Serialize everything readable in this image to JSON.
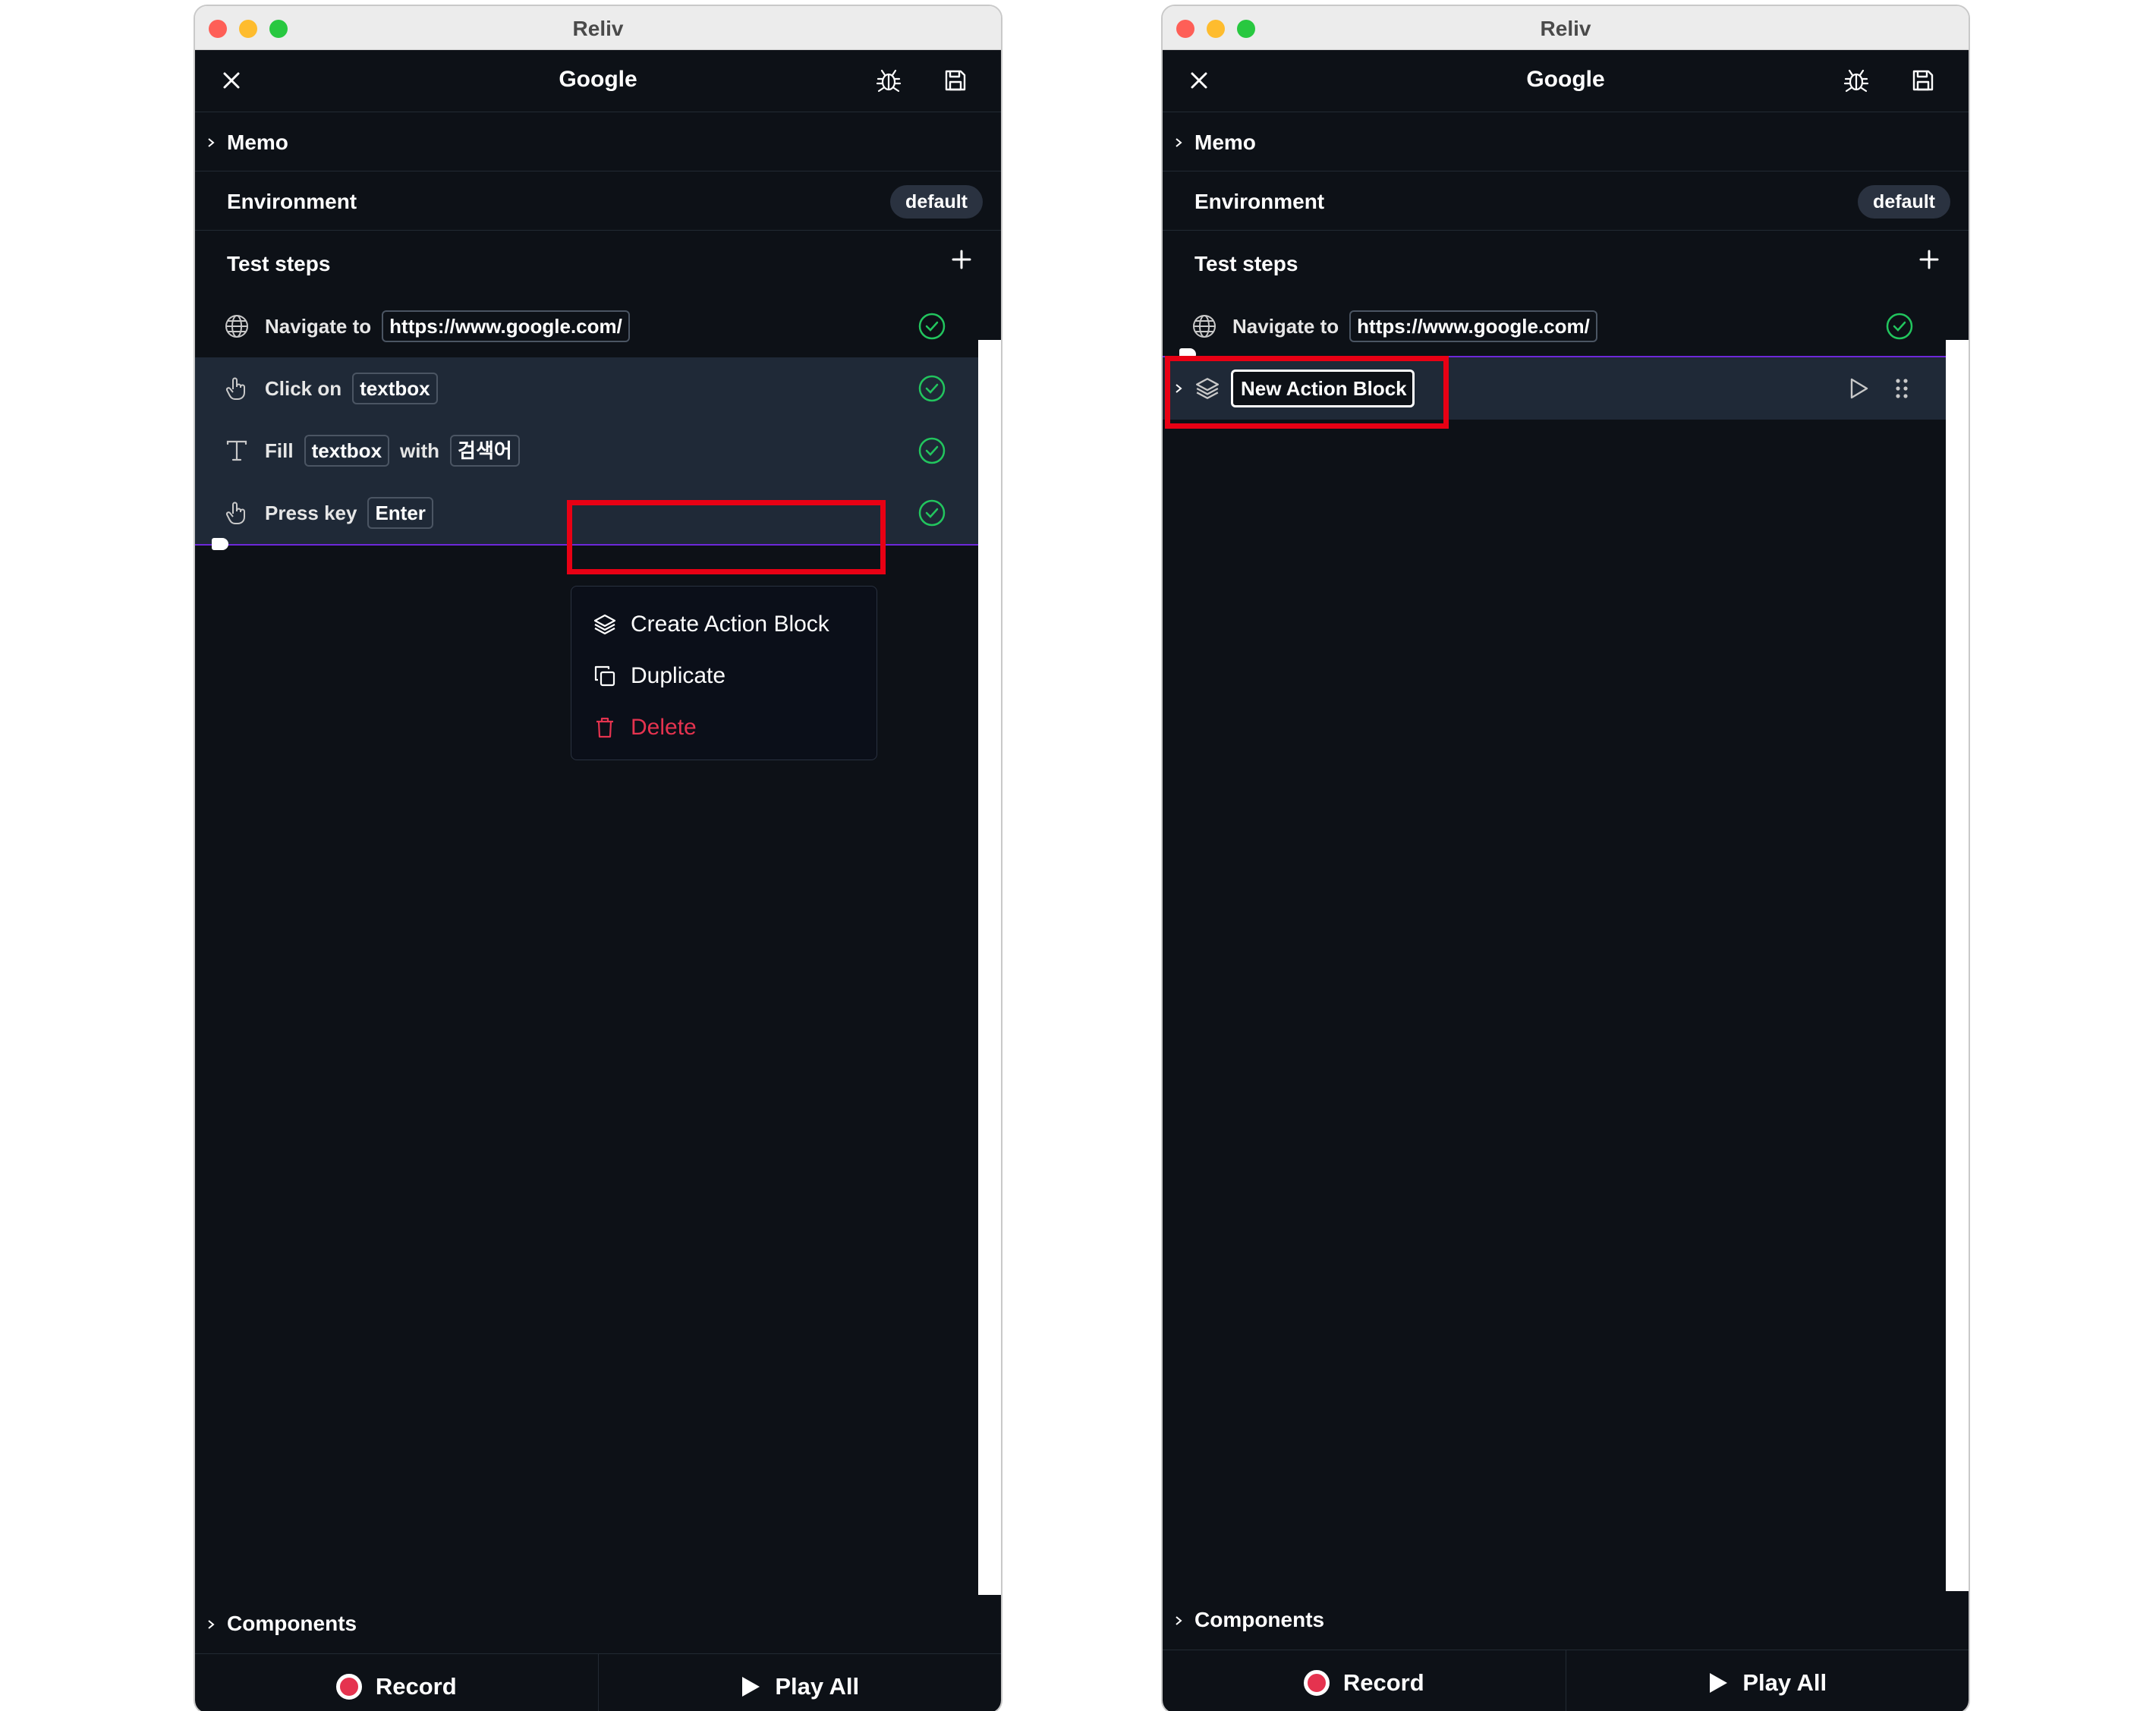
{
  "window": {
    "title": "Reliv"
  },
  "header": {
    "title": "Google"
  },
  "memo": {
    "label": "Memo"
  },
  "environment": {
    "label": "Environment",
    "value": "default"
  },
  "test_steps": {
    "label": "Test steps",
    "steps": [
      {
        "action": "Navigate to",
        "target": "https://www.google.com/"
      },
      {
        "action": "Click on",
        "target": "textbox"
      },
      {
        "action": "Fill",
        "target": "textbox",
        "connector": "with",
        "value": "검색어"
      },
      {
        "action": "Press key",
        "target": "Enter"
      }
    ]
  },
  "context_menu": {
    "items": [
      {
        "label": "Create Action Block",
        "icon": "layers-icon"
      },
      {
        "label": "Duplicate",
        "icon": "copy-icon"
      },
      {
        "label": "Delete",
        "icon": "trash-icon"
      }
    ]
  },
  "action_block": {
    "name": "New Action Block"
  },
  "footer": {
    "components_label": "Components",
    "record_label": "Record",
    "play_all_label": "Play All"
  },
  "colors": {
    "success": "#22c55e",
    "danger": "#e5334f",
    "highlight": "#e80014",
    "selected_bg": "#1f2937",
    "drop_line": "#6d28d9"
  }
}
